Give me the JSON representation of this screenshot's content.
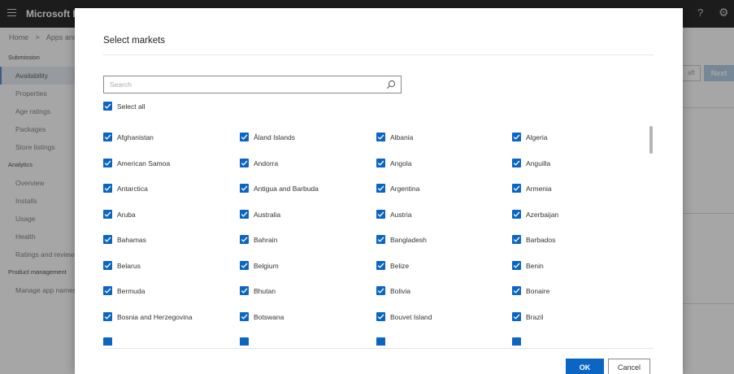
{
  "app": {
    "title": "Microsoft Par"
  },
  "breadcrumb": {
    "home": "Home",
    "sep": ">",
    "current": "Apps and g"
  },
  "sidebar": {
    "sections": [
      {
        "title": "Submission",
        "items": [
          "Availability",
          "Properties",
          "Age ratings",
          "Packages",
          "Store listings"
        ]
      },
      {
        "title": "Analytics",
        "items": [
          "Overview",
          "Installs",
          "Usage",
          "Health",
          "Ratings and reviews"
        ]
      },
      {
        "title": "Product management",
        "items": [
          "Manage app names"
        ]
      }
    ]
  },
  "toolbar": {
    "draft_label": "aft",
    "next_label": "Next"
  },
  "dialog": {
    "title": "Select markets",
    "search_placeholder": "Search",
    "select_all_label": "Select all",
    "select_all_checked": true,
    "markets": [
      "Afghanistan",
      "Åland Islands",
      "Albania",
      "Algeria",
      "American Samoa",
      "Andorra",
      "Angola",
      "Anguilla",
      "Antarctica",
      "Antigua and Barbuda",
      "Argentina",
      "Armenia",
      "Aruba",
      "Australia",
      "Austria",
      "Azerbaijan",
      "Bahamas",
      "Bahrain",
      "Bangladesh",
      "Barbados",
      "Belarus",
      "Belgium",
      "Belize",
      "Benin",
      "Bermuda",
      "Bhutan",
      "Bolivia",
      "Bonaire",
      "Bosnia and Herzegovina",
      "Botswana",
      "Bouvet Island",
      "Brazil"
    ],
    "ok_label": "OK",
    "cancel_label": "Cancel"
  },
  "colors": {
    "accent": "#0a66c2",
    "topbar": "#2b2b2b"
  }
}
